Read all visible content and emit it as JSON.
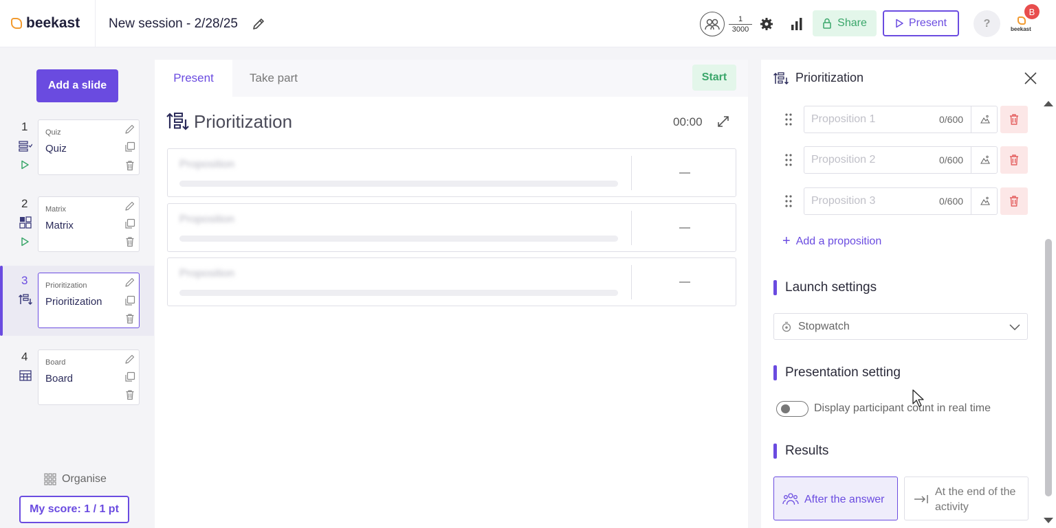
{
  "header": {
    "brand": "beekast",
    "session_title": "New session - 2/28/25",
    "participants": {
      "current": "1",
      "max": "3000"
    },
    "share_label": "Share",
    "present_label": "Present",
    "help_label": "?",
    "avatar_initial": "B",
    "avatar_brand": "beekast"
  },
  "sidebar": {
    "add_slide_label": "Add a slide",
    "slides": [
      {
        "num": "1",
        "category": "Quiz",
        "name": "Quiz",
        "icon": "quiz-icon",
        "played": true
      },
      {
        "num": "2",
        "category": "Matrix",
        "name": "Matrix",
        "icon": "matrix-icon",
        "played": true
      },
      {
        "num": "3",
        "category": "Prioritization",
        "name": "Prioritization",
        "icon": "prioritization-icon",
        "active": true
      },
      {
        "num": "4",
        "category": "Board",
        "name": "Board",
        "icon": "board-icon"
      }
    ],
    "organise_label": "Organise",
    "score_label": "My score: 1 / 1 pt"
  },
  "center": {
    "tabs": [
      {
        "label": "Present",
        "active": true
      },
      {
        "label": "Take part"
      }
    ],
    "start_label": "Start",
    "title": "Prioritization",
    "timer": "00:00",
    "rows": [
      {
        "label": "Proposition",
        "value": "—"
      },
      {
        "label": "Proposition",
        "value": "—"
      },
      {
        "label": "Proposition",
        "value": "—"
      }
    ]
  },
  "panel": {
    "title": "Prioritization",
    "propositions": [
      {
        "placeholder": "Proposition 1",
        "count": "0/600"
      },
      {
        "placeholder": "Proposition 2",
        "count": "0/600"
      },
      {
        "placeholder": "Proposition 3",
        "count": "0/600"
      }
    ],
    "add_proposition_label": "Add a proposition",
    "launch_settings": {
      "heading": "Launch settings",
      "selected": "Stopwatch"
    },
    "presentation_setting": {
      "heading": "Presentation setting",
      "toggle_label": "Display participant count in real time",
      "toggle_on": false
    },
    "results": {
      "heading": "Results",
      "options": [
        {
          "label": "After the answer",
          "active": true
        },
        {
          "label": "At the end of the activity"
        }
      ]
    }
  },
  "colors": {
    "accent": "#6a4be0",
    "success": "#3aa66a",
    "danger": "#e35d5d",
    "brand_orange": "#f29a2e"
  }
}
